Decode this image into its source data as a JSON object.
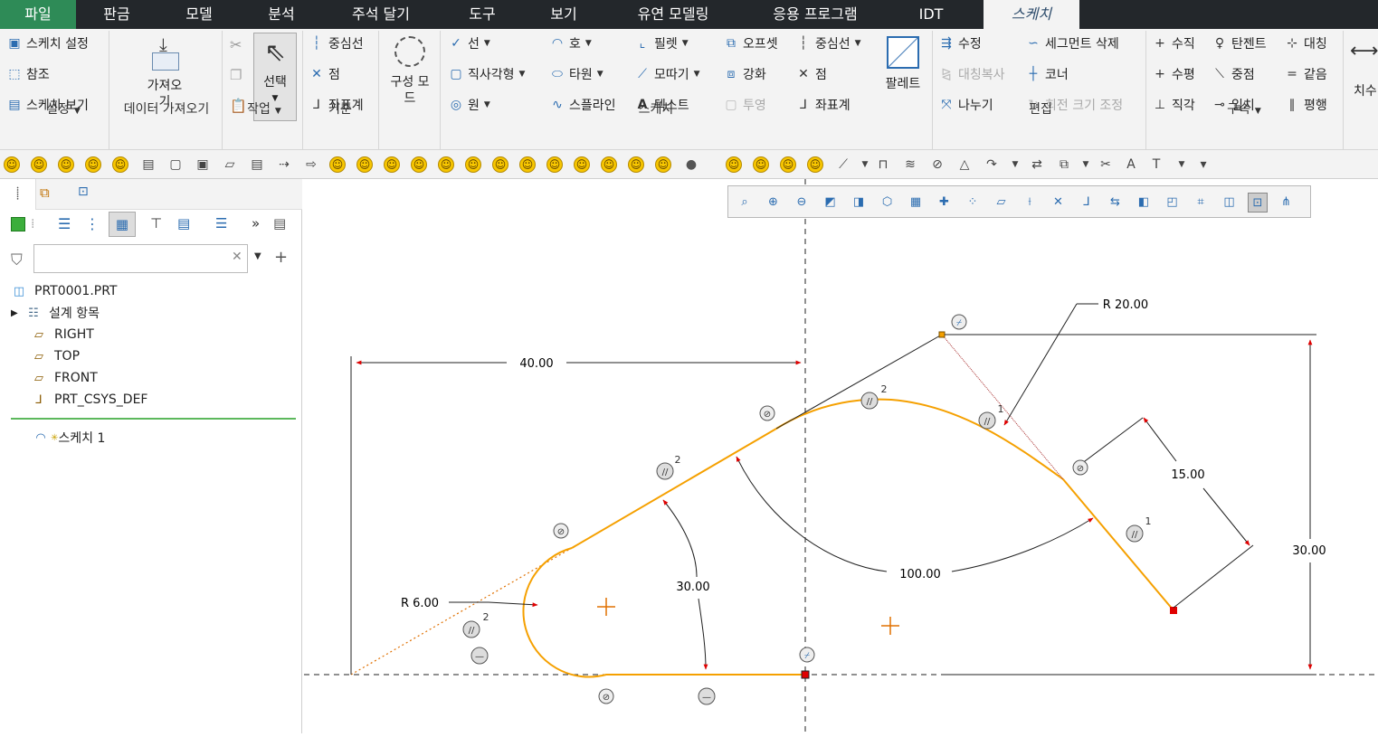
{
  "menu": {
    "file": "파일",
    "sheetmetal": "판금",
    "model": "모델",
    "analysis": "분석",
    "annotate": "주석 달기",
    "tools": "도구",
    "view": "보기",
    "flexible": "유연 모델링",
    "applications": "응용 프로그램",
    "idt": "IDT",
    "sketch": "스케치"
  },
  "ribbon": {
    "setup": {
      "sketch_setup": "스케치 설정",
      "references": "참조",
      "sketch_view": "스케치 보기",
      "group": "설정"
    },
    "data": {
      "import": "가져오\n기",
      "group": "데이터 가져오기"
    },
    "operations": {
      "select": "선택",
      "group": "작업"
    },
    "datum": {
      "centerline": "중심선",
      "point": "점",
      "csys": "좌표계",
      "group": "기준"
    },
    "construction_mode": "구성 모\n드",
    "sketching": {
      "line": "선",
      "rectangle": "직사각형",
      "circle": "원",
      "arc": "호",
      "ellipse": "타원",
      "spline": "스플라인",
      "fillet": "필렛",
      "chamfer": "모따기",
      "text": "텍스트",
      "offset": "오프셋",
      "thicken": "강화",
      "project": "투영",
      "centerline": "중심선",
      "point": "점",
      "csys": "좌표계",
      "palette": "팔레트",
      "group": "스케치"
    },
    "editing": {
      "modify": "수정",
      "delete_segment": "세그먼트 삭제",
      "mirror": "대칭복사",
      "corner": "코너",
      "divide": "나누기",
      "rotate_resize": "회전 크기 조정",
      "group": "편집"
    },
    "constrain": {
      "vertical": "수직",
      "tangent": "탄젠트",
      "symmetric": "대칭",
      "horizontal": "수평",
      "midpoint": "중점",
      "equal": "같음",
      "perpendicular": "직각",
      "coincident": "일치",
      "parallel": "평행",
      "group": "구속"
    },
    "dimension": "치수"
  },
  "tree": {
    "filter_placeholder": "",
    "part": "PRT0001.PRT",
    "design_items": "설계 항목",
    "right": "RIGHT",
    "top": "TOP",
    "front": "FRONT",
    "csys": "PRT_CSYS_DEF",
    "sketch": "스케치 1"
  },
  "sketch_dims": {
    "d40": "40.00",
    "r20": "R 20.00",
    "d15": "15.00",
    "d30v": "30.00",
    "d100": "100.00",
    "a30": "30.00",
    "r6": "R 6.00",
    "p2a": "2",
    "p2b": "2",
    "p2c": "2",
    "p1a": "1",
    "p1b": "1"
  },
  "colors": {
    "menubar": "#23272b",
    "file_tab": "#2e8b57",
    "geometry": "#f5a000",
    "dimension": "#000000",
    "arrow": "#e00000"
  }
}
